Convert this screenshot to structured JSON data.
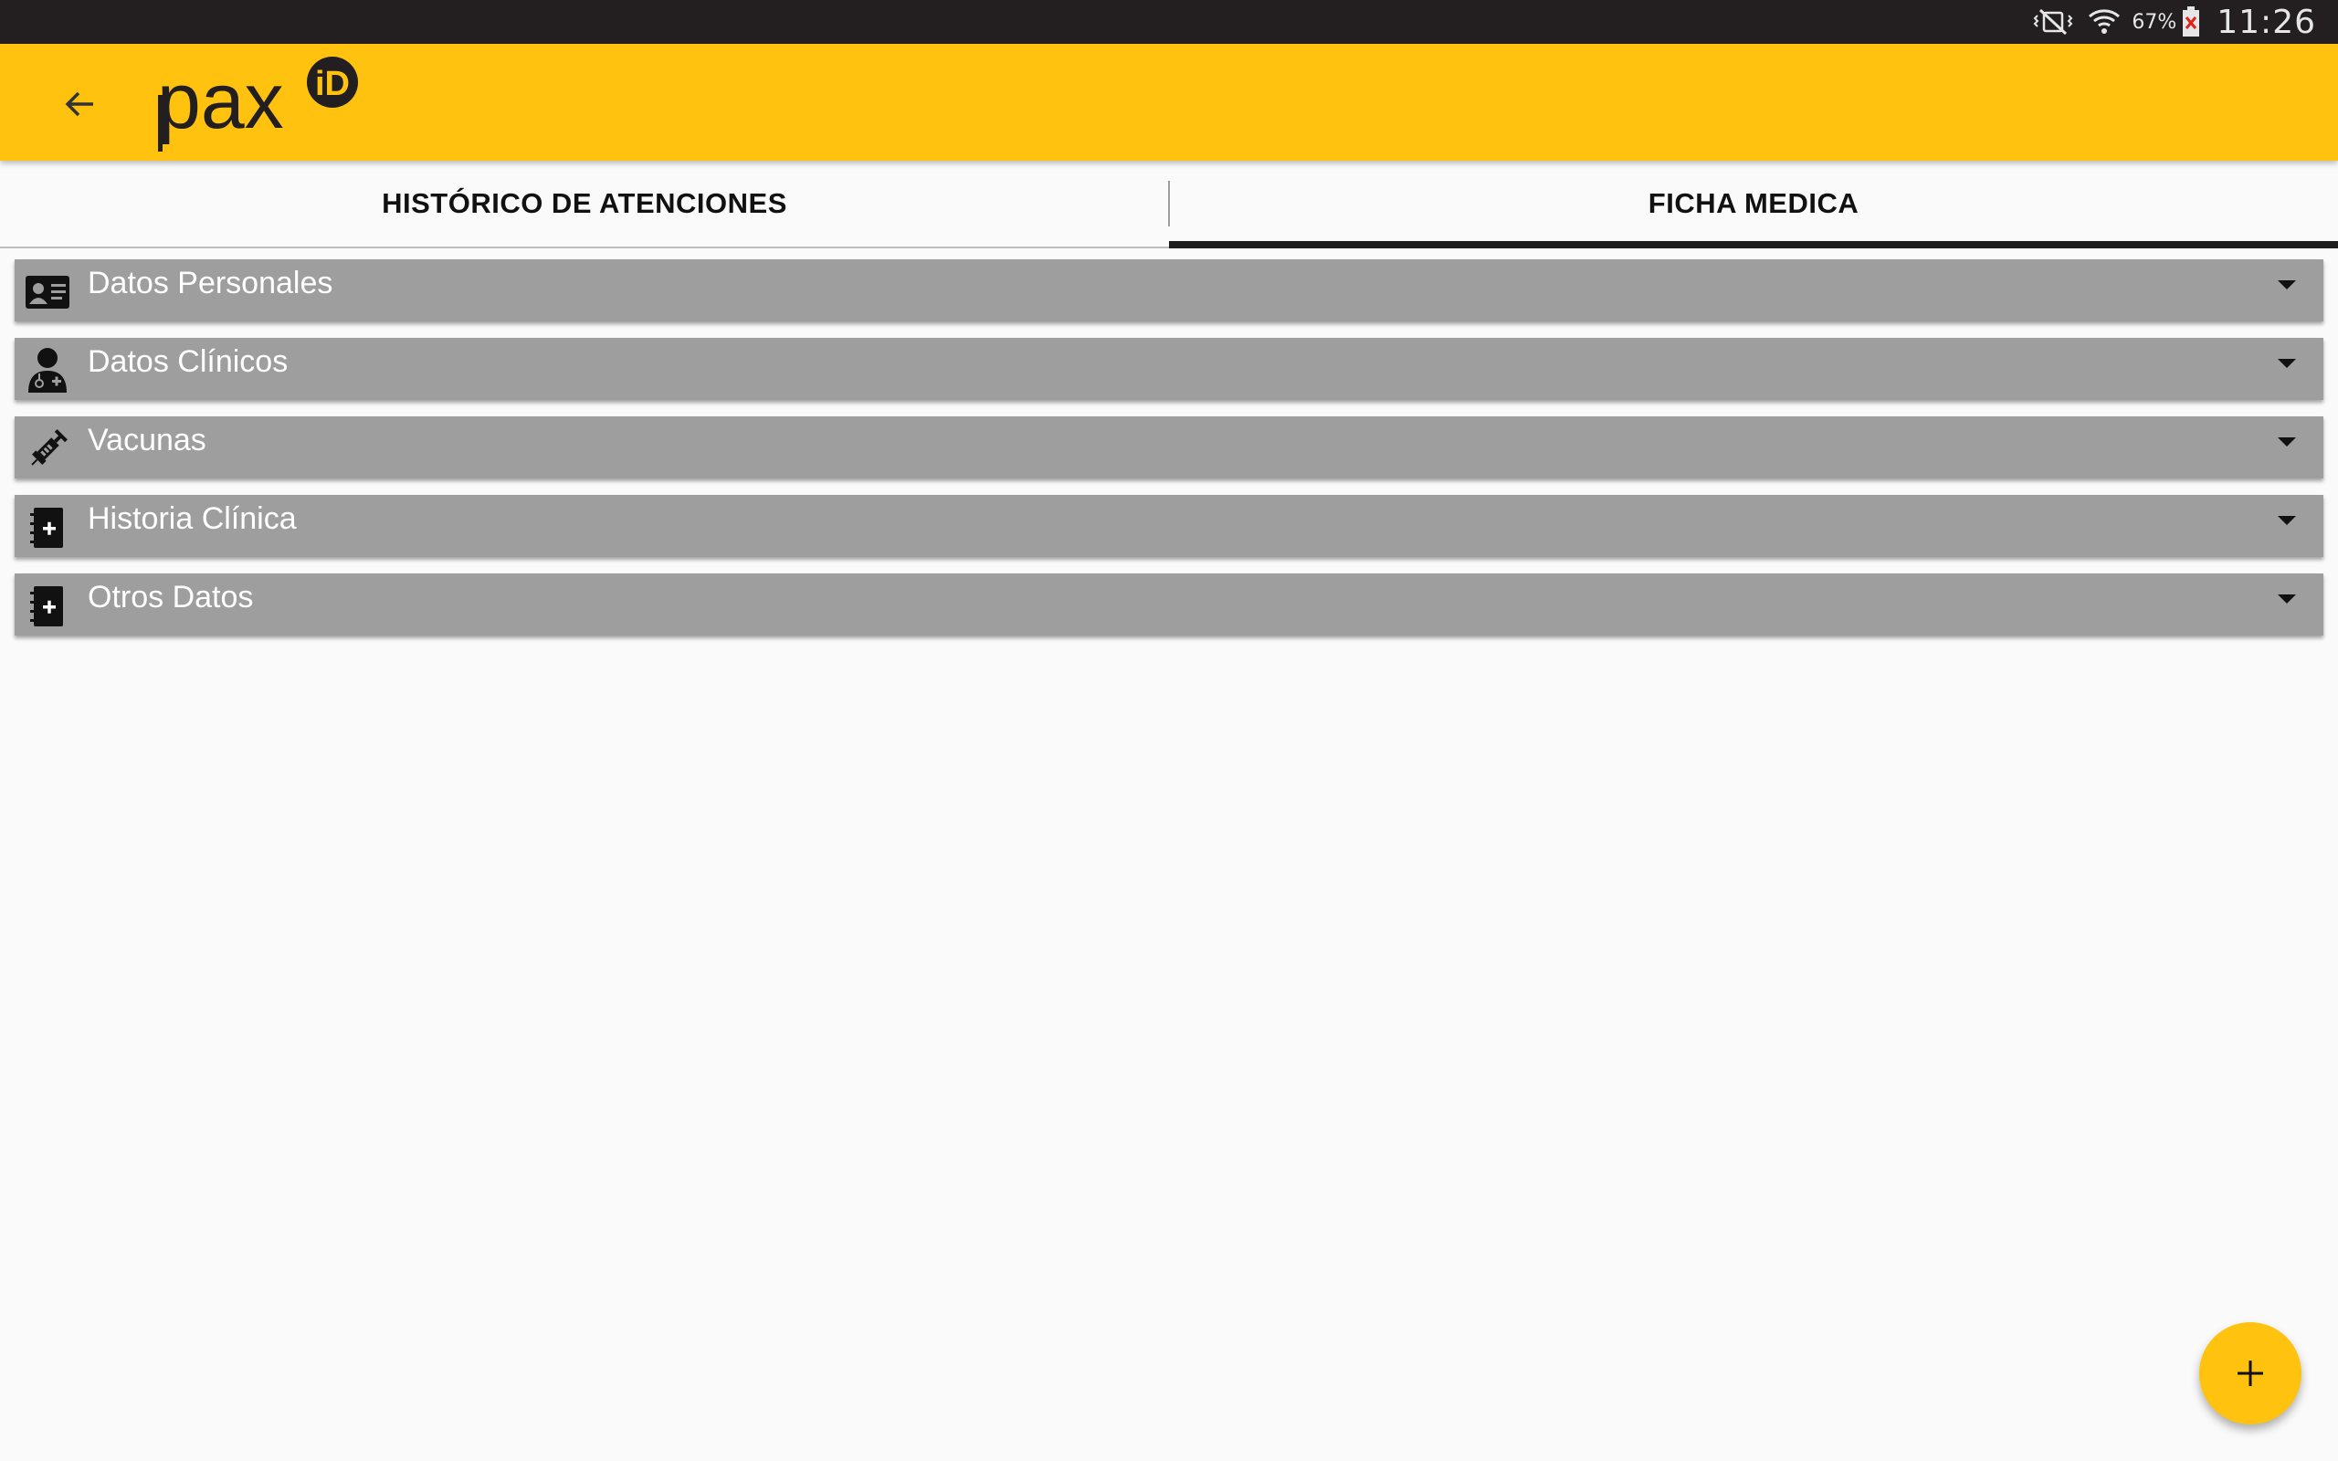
{
  "status_bar": {
    "battery_percent": "67%",
    "time": "11:26",
    "icons": [
      "vibrate-mute-icon",
      "wifi-icon",
      "battery-warning-icon"
    ]
  },
  "app_bar": {
    "back_icon": "arrow-back-icon",
    "logo_text": "pax",
    "logo_badge": "iD",
    "brand_color": "#ffc20e"
  },
  "tabs": [
    {
      "label": "HISTÓRICO DE ATENCIONES",
      "active": false
    },
    {
      "label": "FICHA MEDICA",
      "active": true
    }
  ],
  "sections": [
    {
      "label": "Datos Personales",
      "icon": "id-card-icon"
    },
    {
      "label": "Datos Clínicos",
      "icon": "doctor-icon"
    },
    {
      "label": "Vacunas",
      "icon": "syringe-icon"
    },
    {
      "label": "Historia Clínica",
      "icon": "medical-book-icon"
    },
    {
      "label": "Otros Datos",
      "icon": "medical-book-icon"
    }
  ],
  "fab": {
    "icon": "plus-icon"
  },
  "colors": {
    "accent": "#ffc20e",
    "section_background": "#9e9e9e",
    "status_bar": "#231f20"
  }
}
